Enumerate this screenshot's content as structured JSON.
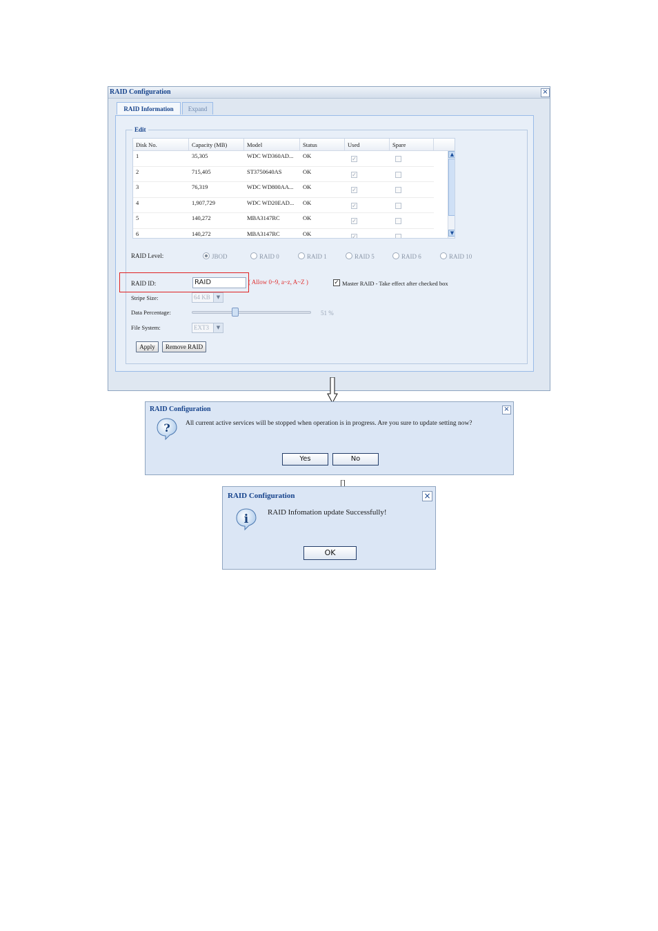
{
  "main_window": {
    "title": "RAID Configuration",
    "close": "×",
    "tabs": [
      "RAID Information",
      "Expand"
    ],
    "fieldset_legend": "Edit",
    "table": {
      "headers": [
        "Disk No.",
        "Capacity (MB)",
        "Model",
        "Status",
        "Used",
        "Spare"
      ],
      "rows": [
        {
          "disk": "1",
          "capacity": "35,305",
          "model": "WDC WD360AD...",
          "status": "OK"
        },
        {
          "disk": "2",
          "capacity": "715,405",
          "model": "ST3750640AS",
          "status": "OK"
        },
        {
          "disk": "3",
          "capacity": "76,319",
          "model": "WDC WD800AA...",
          "status": "OK"
        },
        {
          "disk": "4",
          "capacity": "1,907,729",
          "model": "WDC WD20EAD...",
          "status": "OK"
        },
        {
          "disk": "5",
          "capacity": "140,272",
          "model": "MBA3147RC",
          "status": "OK"
        },
        {
          "disk": "6",
          "capacity": "140,272",
          "model": "MBA3147RC",
          "status": "OK"
        }
      ]
    },
    "raid_level": {
      "label": "RAID Level:",
      "options": [
        "JBOD",
        "RAID 0",
        "RAID 1",
        "RAID 5",
        "RAID 6",
        "RAID 10"
      ],
      "selected": "JBOD"
    },
    "raid_id": {
      "label": "RAID ID:",
      "value": "RAID",
      "hint": "( Allow 0~9, a~z, A~Z )"
    },
    "master_raid": {
      "checked": true,
      "label": "Master RAID - Take effect after checked box"
    },
    "stripe_size": {
      "label": "Stripe Size:",
      "value": "64 KB"
    },
    "data_percentage": {
      "label": "Data Percentage:",
      "value": "51 %",
      "level": 0.51
    },
    "file_system": {
      "label": "File System:",
      "value": "EXT3"
    },
    "buttons": {
      "apply": "Apply",
      "remove": "Remove RAID"
    }
  },
  "confirm_dialog": {
    "title": "RAID Configuration",
    "message": "All current active services will be stopped when operation is in progress. Are you sure to update setting now?",
    "yes": "Yes",
    "no": "No"
  },
  "success_dialog": {
    "title": "RAID Configuration",
    "message": "RAID Infomation update Successfully!",
    "ok": "OK"
  },
  "icons": {
    "question": "question-icon",
    "info": "info-icon"
  }
}
